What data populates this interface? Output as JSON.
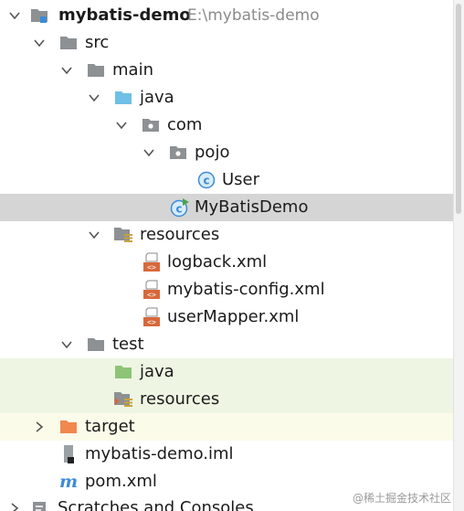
{
  "project": {
    "name": "mybatis-demo",
    "path": "E:\\mybatis-demo"
  },
  "tree": {
    "src": "src",
    "main": "main",
    "main_java": "java",
    "com": "com",
    "pojo": "pojo",
    "user_class": "User",
    "mybatisdemo_class": "MyBatisDemo",
    "resources": "resources",
    "logback": "logback.xml",
    "mybatis_config": "mybatis-config.xml",
    "user_mapper": "userMapper.xml",
    "test": "test",
    "test_java": "java",
    "test_resources": "resources",
    "target": "target",
    "iml": "mybatis-demo.iml",
    "pom": "pom.xml",
    "scratches": "Scratches and Consoles"
  },
  "icons": {
    "project": "module-icon",
    "folder": "folder-icon",
    "source_root": "source-folder-icon",
    "package": "package-icon",
    "class": "class-icon",
    "main_class": "runnable-class-icon",
    "resources_root": "resources-folder-icon",
    "xml": "xml-file-icon",
    "test_root": "test-source-folder-icon",
    "test_resources_root": "test-resources-folder-icon",
    "excluded": "excluded-folder-icon",
    "iml": "iml-file-icon",
    "maven": "maven-icon",
    "scratches": "scratches-icon"
  },
  "colors": {
    "selected_row": "#d5d5d5",
    "test_tint": "#eef6e3",
    "excluded_tint": "#fbfbe9",
    "folder_gray": "#8d9194",
    "source_blue": "#6fbfe6",
    "test_green": "#8dc476",
    "excluded_orange": "#f0884f",
    "class_blue": "#3c8bd6",
    "xml_orange": "#d8683b"
  },
  "watermark": "@稀土掘金技术社区"
}
